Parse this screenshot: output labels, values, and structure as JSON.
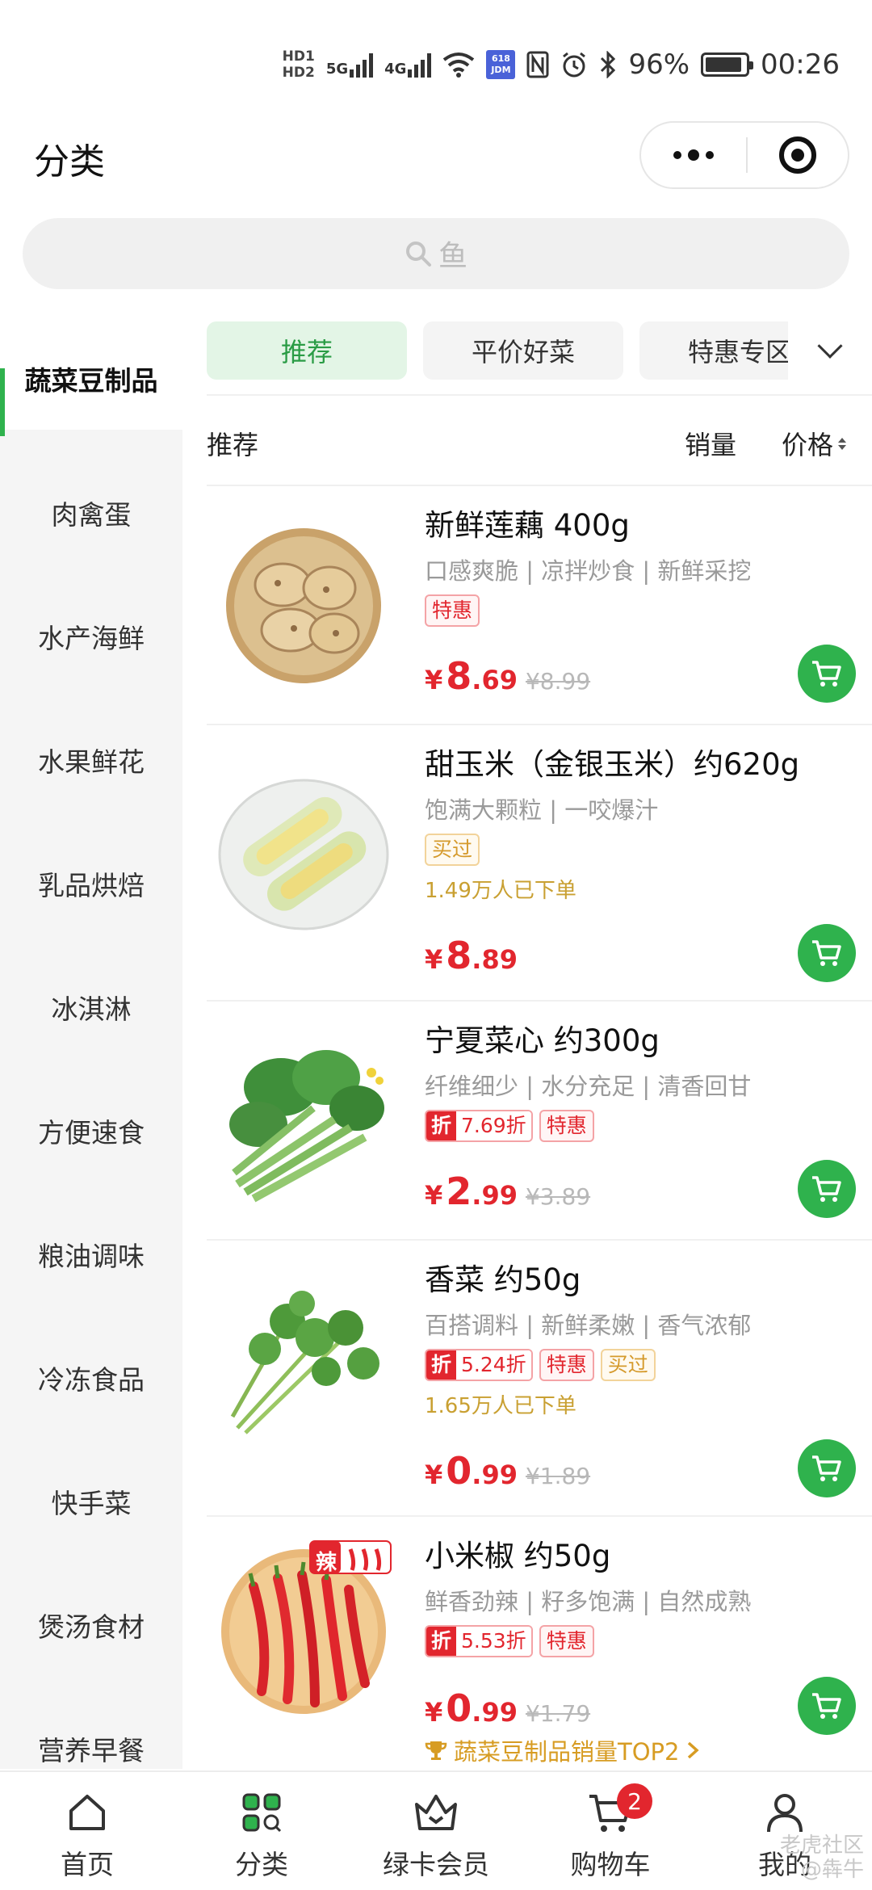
{
  "status_bar": {
    "hd1": "HD1",
    "hd2": "HD2",
    "net1": "5G",
    "net2": "4G",
    "app_badge": "618 JDM",
    "battery": "96%",
    "time": "00:26"
  },
  "header": {
    "title": "分类"
  },
  "search": {
    "placeholder": "鱼"
  },
  "sidebar": {
    "items": [
      {
        "label": "蔬菜豆制品"
      },
      {
        "label": "肉禽蛋"
      },
      {
        "label": "水产海鲜"
      },
      {
        "label": "水果鲜花"
      },
      {
        "label": "乳品烘焙"
      },
      {
        "label": "冰淇淋"
      },
      {
        "label": "方便速食"
      },
      {
        "label": "粮油调味"
      },
      {
        "label": "冷冻食品"
      },
      {
        "label": "快手菜"
      },
      {
        "label": "煲汤食材"
      },
      {
        "label": "营养早餐"
      }
    ]
  },
  "tabs": [
    {
      "label": "推荐"
    },
    {
      "label": "平价好菜"
    },
    {
      "label": "特惠专区"
    }
  ],
  "sort": {
    "recommend": "推荐",
    "sales": "销量",
    "price": "价格"
  },
  "products": [
    {
      "name": "新鲜莲藕 400g",
      "desc": "口感爽脆 | 凉拌炒食 | 新鲜采挖",
      "tags": {
        "sale": "特惠"
      },
      "price": {
        "currency": "¥",
        "int": "8",
        "dec": ".69",
        "orig": "¥8.99"
      }
    },
    {
      "name": "甜玉米（金银玉米）约620g",
      "desc": "饱满大颗粒 | 一咬爆汁",
      "tags": {
        "bought": "买过"
      },
      "sold": "1.49万人已下单",
      "price": {
        "currency": "¥",
        "int": "8",
        "dec": ".89"
      }
    },
    {
      "name": "宁夏菜心 约300g",
      "desc": "纤维细少 | 水分充足 | 清香回甘",
      "tags": {
        "zhe": "折",
        "discount": "7.69折",
        "sale": "特惠"
      },
      "price": {
        "currency": "¥",
        "int": "2",
        "dec": ".99",
        "orig": "¥3.89"
      }
    },
    {
      "name": "香菜 约50g",
      "desc": "百搭调料 | 新鲜柔嫩 | 香气浓郁",
      "tags": {
        "zhe": "折",
        "discount": "5.24折",
        "sale": "特惠",
        "bought": "买过"
      },
      "sold": "1.65万人已下单",
      "price": {
        "currency": "¥",
        "int": "0",
        "dec": ".99",
        "orig": "¥1.89"
      }
    },
    {
      "name": "小米椒 约50g",
      "desc": "鲜香劲辣 | 籽多饱满 | 自然成熟",
      "tags": {
        "zhe": "折",
        "discount": "5.53折",
        "sale": "特惠"
      },
      "spicy": "辣",
      "price": {
        "currency": "¥",
        "int": "0",
        "dec": ".99",
        "orig": "¥1.79"
      }
    }
  ],
  "rank_text": "蔬菜豆制品销量TOP2",
  "bottom_nav": {
    "home": "首页",
    "category": "分类",
    "member": "绿卡会员",
    "cart": "购物车",
    "cart_count": "2",
    "mine": "我的"
  },
  "watermark": {
    "line1": "老虎社区",
    "line2": "@犇牛"
  },
  "colors": {
    "accent": "#2fb24d",
    "price": "#e2262e",
    "gold": "#d59a2c"
  },
  "icons": [
    "search-icon",
    "more-icon",
    "close-icon",
    "chevron-down-icon",
    "cart-icon",
    "trophy-icon",
    "home-icon",
    "category-icon",
    "member-icon",
    "user-icon"
  ]
}
